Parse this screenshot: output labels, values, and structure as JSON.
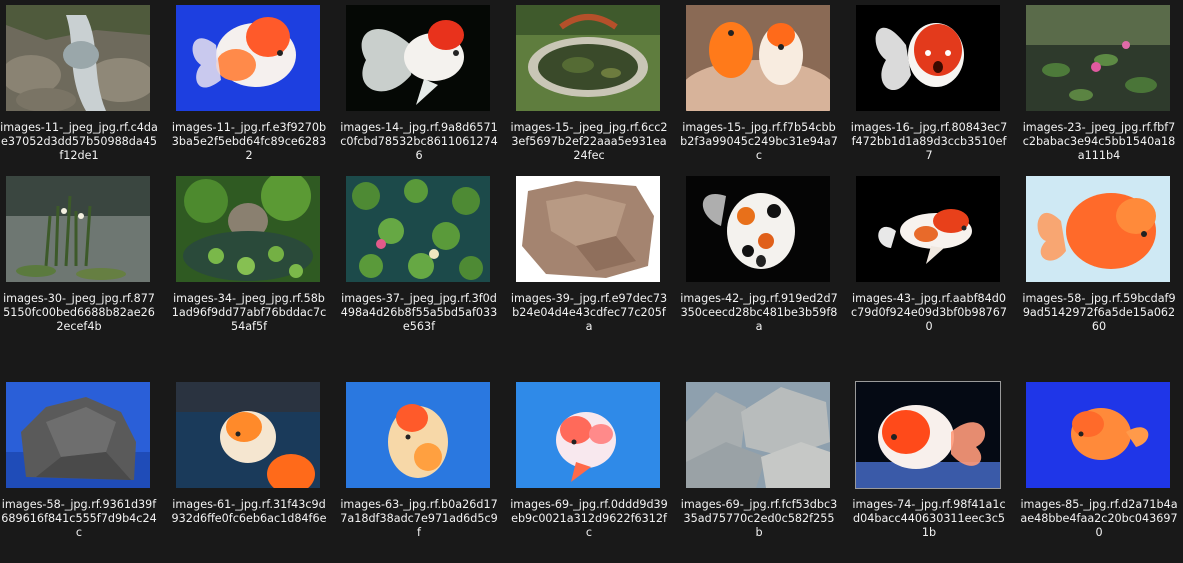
{
  "items": [
    {
      "label": "images-11-_jpeg_jpg.rf.c4dae37052d3dd57b50988da45f12de1",
      "icon": "stream-rocks-photo"
    },
    {
      "label": "images-11-_jpg.rf.e3f9270b3ba5e2f5ebd64fc89ce62832",
      "icon": "goldfish-blue-photo"
    },
    {
      "label": "images-14-_jpg.rf.9a8d6571c0fcbd78532bc86110612746",
      "icon": "goldfish-black-photo"
    },
    {
      "label": "images-15-_jpeg_jpg.rf.6cc23ef5697b2ef22aaa5e931ea24fec",
      "icon": "garden-pond-bridge-photo"
    },
    {
      "label": "images-15-_jpg.rf.f7b54cbbb2f3a99045c249bc31e94a7c",
      "icon": "goldfish-hands-photo"
    },
    {
      "label": "images-16-_jpg.rf.80843ec7f472bb1d1a89d3ccb3510ef7",
      "icon": "goldfish-black-photo"
    },
    {
      "label": "images-23-_jpeg_jpg.rf.fbf7c2babac3e94c5bb1540a18a111b4",
      "icon": "lily-pond-photo"
    },
    {
      "label": "images-30-_jpeg_jpg.rf.8775150fc00bed6688b82ae262ecef4b",
      "icon": "pond-reeds-photo"
    },
    {
      "label": "images-34-_jpeg_jpg.rf.58b1ad96f9dd77abf76bddac7c54af5f",
      "icon": "garden-pond-plants-photo"
    },
    {
      "label": "images-37-_jpeg_jpg.rf.3f0d498a4d26b8f55a5bd5af033e563f",
      "icon": "lily-pads-photo"
    },
    {
      "label": "images-39-_jpg.rf.e97dec73b24e04d4e43cdfec77c205fa",
      "icon": "brown-rock-photo"
    },
    {
      "label": "images-42-_jpg.rf.919ed2d7350ceecd28bc481be3b59f8a",
      "icon": "goldfish-calico-photo"
    },
    {
      "label": "images-43-_jpg.rf.aabf84d0c79d0f924e09d3bf0b987670",
      "icon": "goldfish-black-photo"
    },
    {
      "label": "images-58-_jpg.rf.59bcdaf99ad5142972f6a5de15a06260",
      "icon": "goldfish-light-photo"
    },
    {
      "label": "images-58-_jpg.rf.9361d39f689616f841c555f7d9b4c24c",
      "icon": "grey-rock-photo"
    },
    {
      "label": "images-61-_jpg.rf.31f43c9d932d6ffe0fc6eb6ac1d84f6e",
      "icon": "goldfish-tank-photo"
    },
    {
      "label": "images-63-_jpg.rf.b0a26d177a18df38adc7e971ad6d5c9f",
      "icon": "goldfish-blue-photo"
    },
    {
      "label": "images-69-_jpg.rf.0ddd9d39eb9c0021a312d9622f6312fc",
      "icon": "goldfish-blue-photo"
    },
    {
      "label": "images-69-_jpg.rf.fcf53dbc335ad75770c2ed0c582f255b",
      "icon": "boulders-photo"
    },
    {
      "label": "images-74-_jpg.rf.98f41a1cd04bacc440630311eec3c51b",
      "icon": "goldfish-gravel-photo"
    },
    {
      "label": "images-85-_jpg.rf.d2a71b4aae48bbe4faa2c20bc0436970",
      "icon": "goldfish-blue-photo"
    }
  ]
}
